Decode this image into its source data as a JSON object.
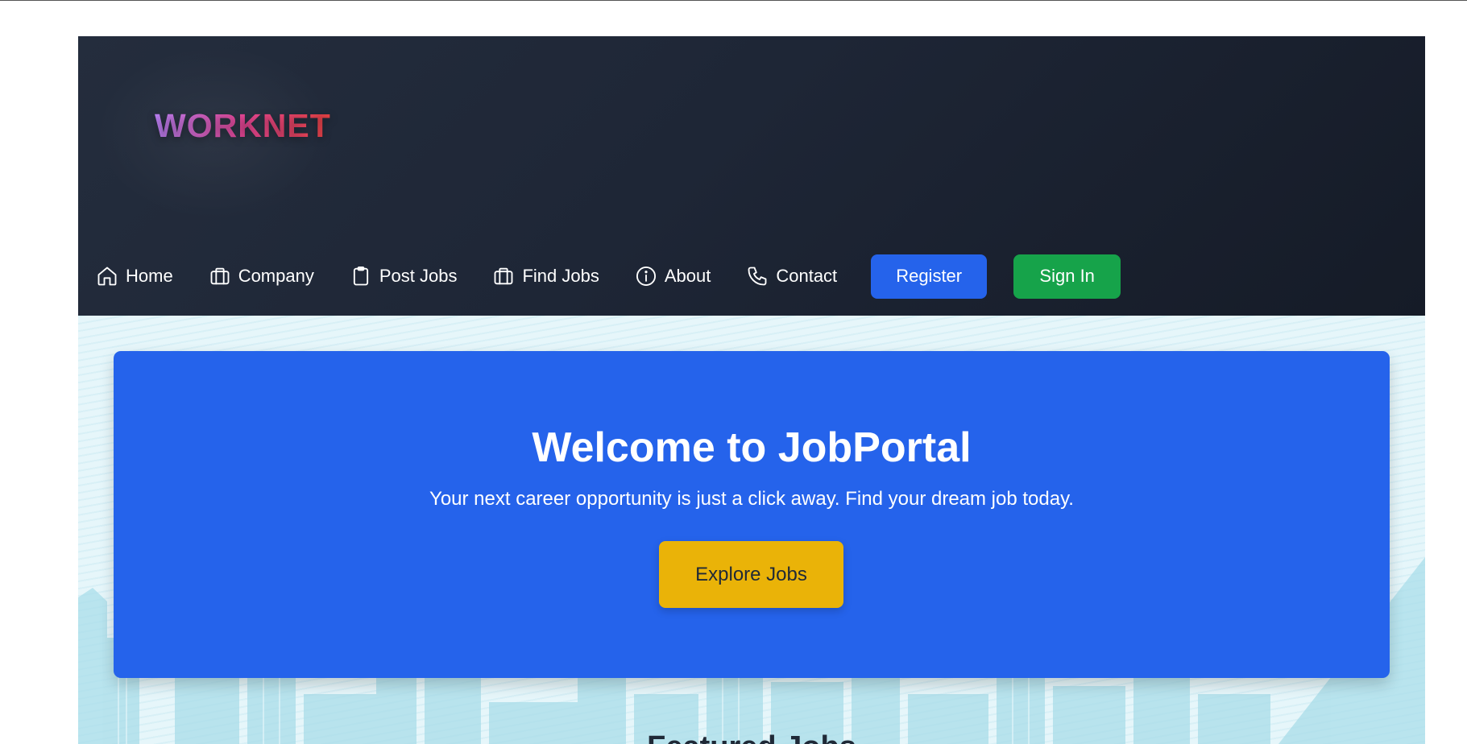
{
  "brand": {
    "logo_text": "WORKNET"
  },
  "nav": {
    "items": [
      {
        "label": "Home",
        "icon": "home-icon"
      },
      {
        "label": "Company",
        "icon": "briefcase-icon"
      },
      {
        "label": "Post Jobs",
        "icon": "clipboard-icon"
      },
      {
        "label": "Find Jobs",
        "icon": "briefcase-icon"
      },
      {
        "label": "About",
        "icon": "info-icon"
      },
      {
        "label": "Contact",
        "icon": "phone-icon"
      }
    ],
    "register_label": "Register",
    "signin_label": "Sign In"
  },
  "hero": {
    "title": "Welcome to JobPortal",
    "subtitle": "Your next career opportunity is just a click away. Find your dream job today.",
    "cta_label": "Explore Jobs"
  },
  "section": {
    "heading": "Featured Jobs"
  },
  "colors": {
    "header_bg": "#1e2636",
    "hero_bg": "#2563eb",
    "register_bg": "#2563eb",
    "signin_bg": "#16a34a",
    "cta_bg": "#eab308",
    "logo_gradient": [
      "#c084fc",
      "#ec4899",
      "#ef4444"
    ]
  }
}
